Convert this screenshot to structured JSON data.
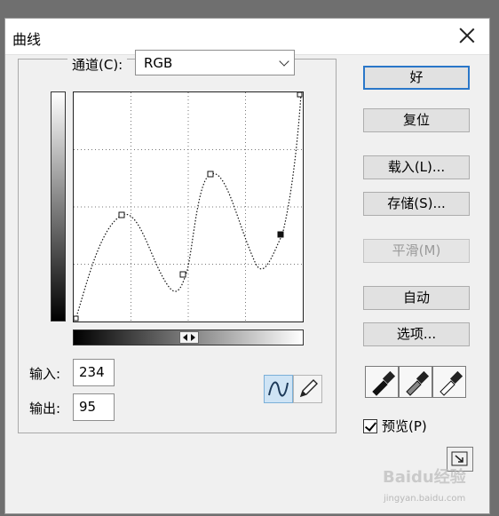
{
  "window": {
    "title": "曲线"
  },
  "channel": {
    "label": "通道(C):",
    "value": "RGB"
  },
  "curve": {
    "grid_divisions": 4,
    "tool_icons": [
      "curve-tool-icon",
      "pencil-tool-icon"
    ]
  },
  "fields": {
    "input_label": "输入:",
    "input_value": "234",
    "output_label": "输出:",
    "output_value": "95"
  },
  "buttons": {
    "ok": "好",
    "reset": "复位",
    "load": "载入(L)...",
    "save": "存储(S)...",
    "smooth": "平滑(M)",
    "auto": "自动",
    "options": "选项..."
  },
  "preview": {
    "label": "预览(P)",
    "checked": true
  },
  "eyedroppers": [
    "black-point-eyedropper-icon",
    "gray-point-eyedropper-icon",
    "white-point-eyedropper-icon"
  ],
  "watermark": {
    "brand": "Baidu经验",
    "url": "jingyan.baidu.com"
  },
  "colors": {
    "default_button_border": "#2a77c9",
    "tool_active": "#cfe4f5"
  }
}
